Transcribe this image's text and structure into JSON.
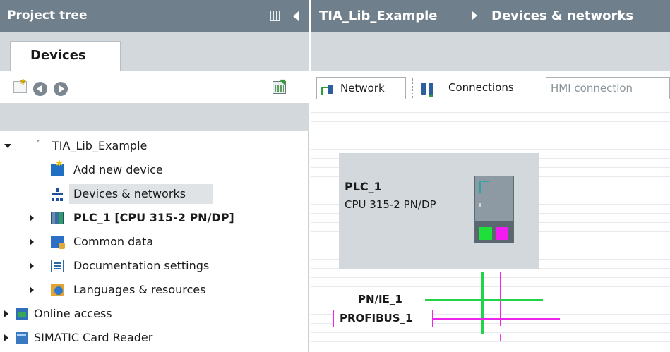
{
  "project_tree": {
    "title": "Project tree",
    "tab_label": "Devices",
    "toolbar_icons": [
      "new-folder-icon",
      "back-icon",
      "forward-icon",
      "show-overview-icon"
    ],
    "items": [
      {
        "label": "TIA_Lib_Example",
        "icon": "project-icon",
        "expanded": true,
        "level": 0
      },
      {
        "label": "Add new device",
        "icon": "add-device-icon",
        "level": 1
      },
      {
        "label": "Devices & networks",
        "icon": "network-icon",
        "level": 1,
        "selected": true
      },
      {
        "label": "PLC_1 [CPU 315-2 PN/DP]",
        "icon": "plc-icon",
        "level": 1,
        "bold": true,
        "expanded": false
      },
      {
        "label": "Common data",
        "icon": "common-data-icon",
        "level": 1,
        "expanded": false
      },
      {
        "label": "Documentation settings",
        "icon": "documentation-icon",
        "level": 1,
        "expanded": false
      },
      {
        "label": "Languages & resources",
        "icon": "languages-icon",
        "level": 1,
        "expanded": false
      },
      {
        "label": "Online access",
        "icon": "online-access-icon",
        "level": 0,
        "expanded": false
      },
      {
        "label": "SIMATIC Card Reader",
        "icon": "card-reader-icon",
        "level": 0,
        "expanded": false
      }
    ]
  },
  "editor": {
    "breadcrumb": [
      "TIA_Lib_Example",
      "Devices & networks"
    ],
    "toolbar": {
      "network_label": "Network",
      "connections_label": "Connections",
      "connection_type": "HMI connection"
    },
    "station": {
      "name": "PLC_1",
      "type": "CPU 315-2 PN/DP"
    },
    "subnets": [
      {
        "name": "PN/IE_1",
        "color": "#22d34a"
      },
      {
        "name": "PROFIBUS_1",
        "color": "#ee26ec"
      }
    ]
  },
  "colors": {
    "title_bar": "#6f7f8b",
    "panel_grey": "#d3d8dc",
    "profinet": "#22d34a",
    "profibus": "#ee26ec"
  }
}
